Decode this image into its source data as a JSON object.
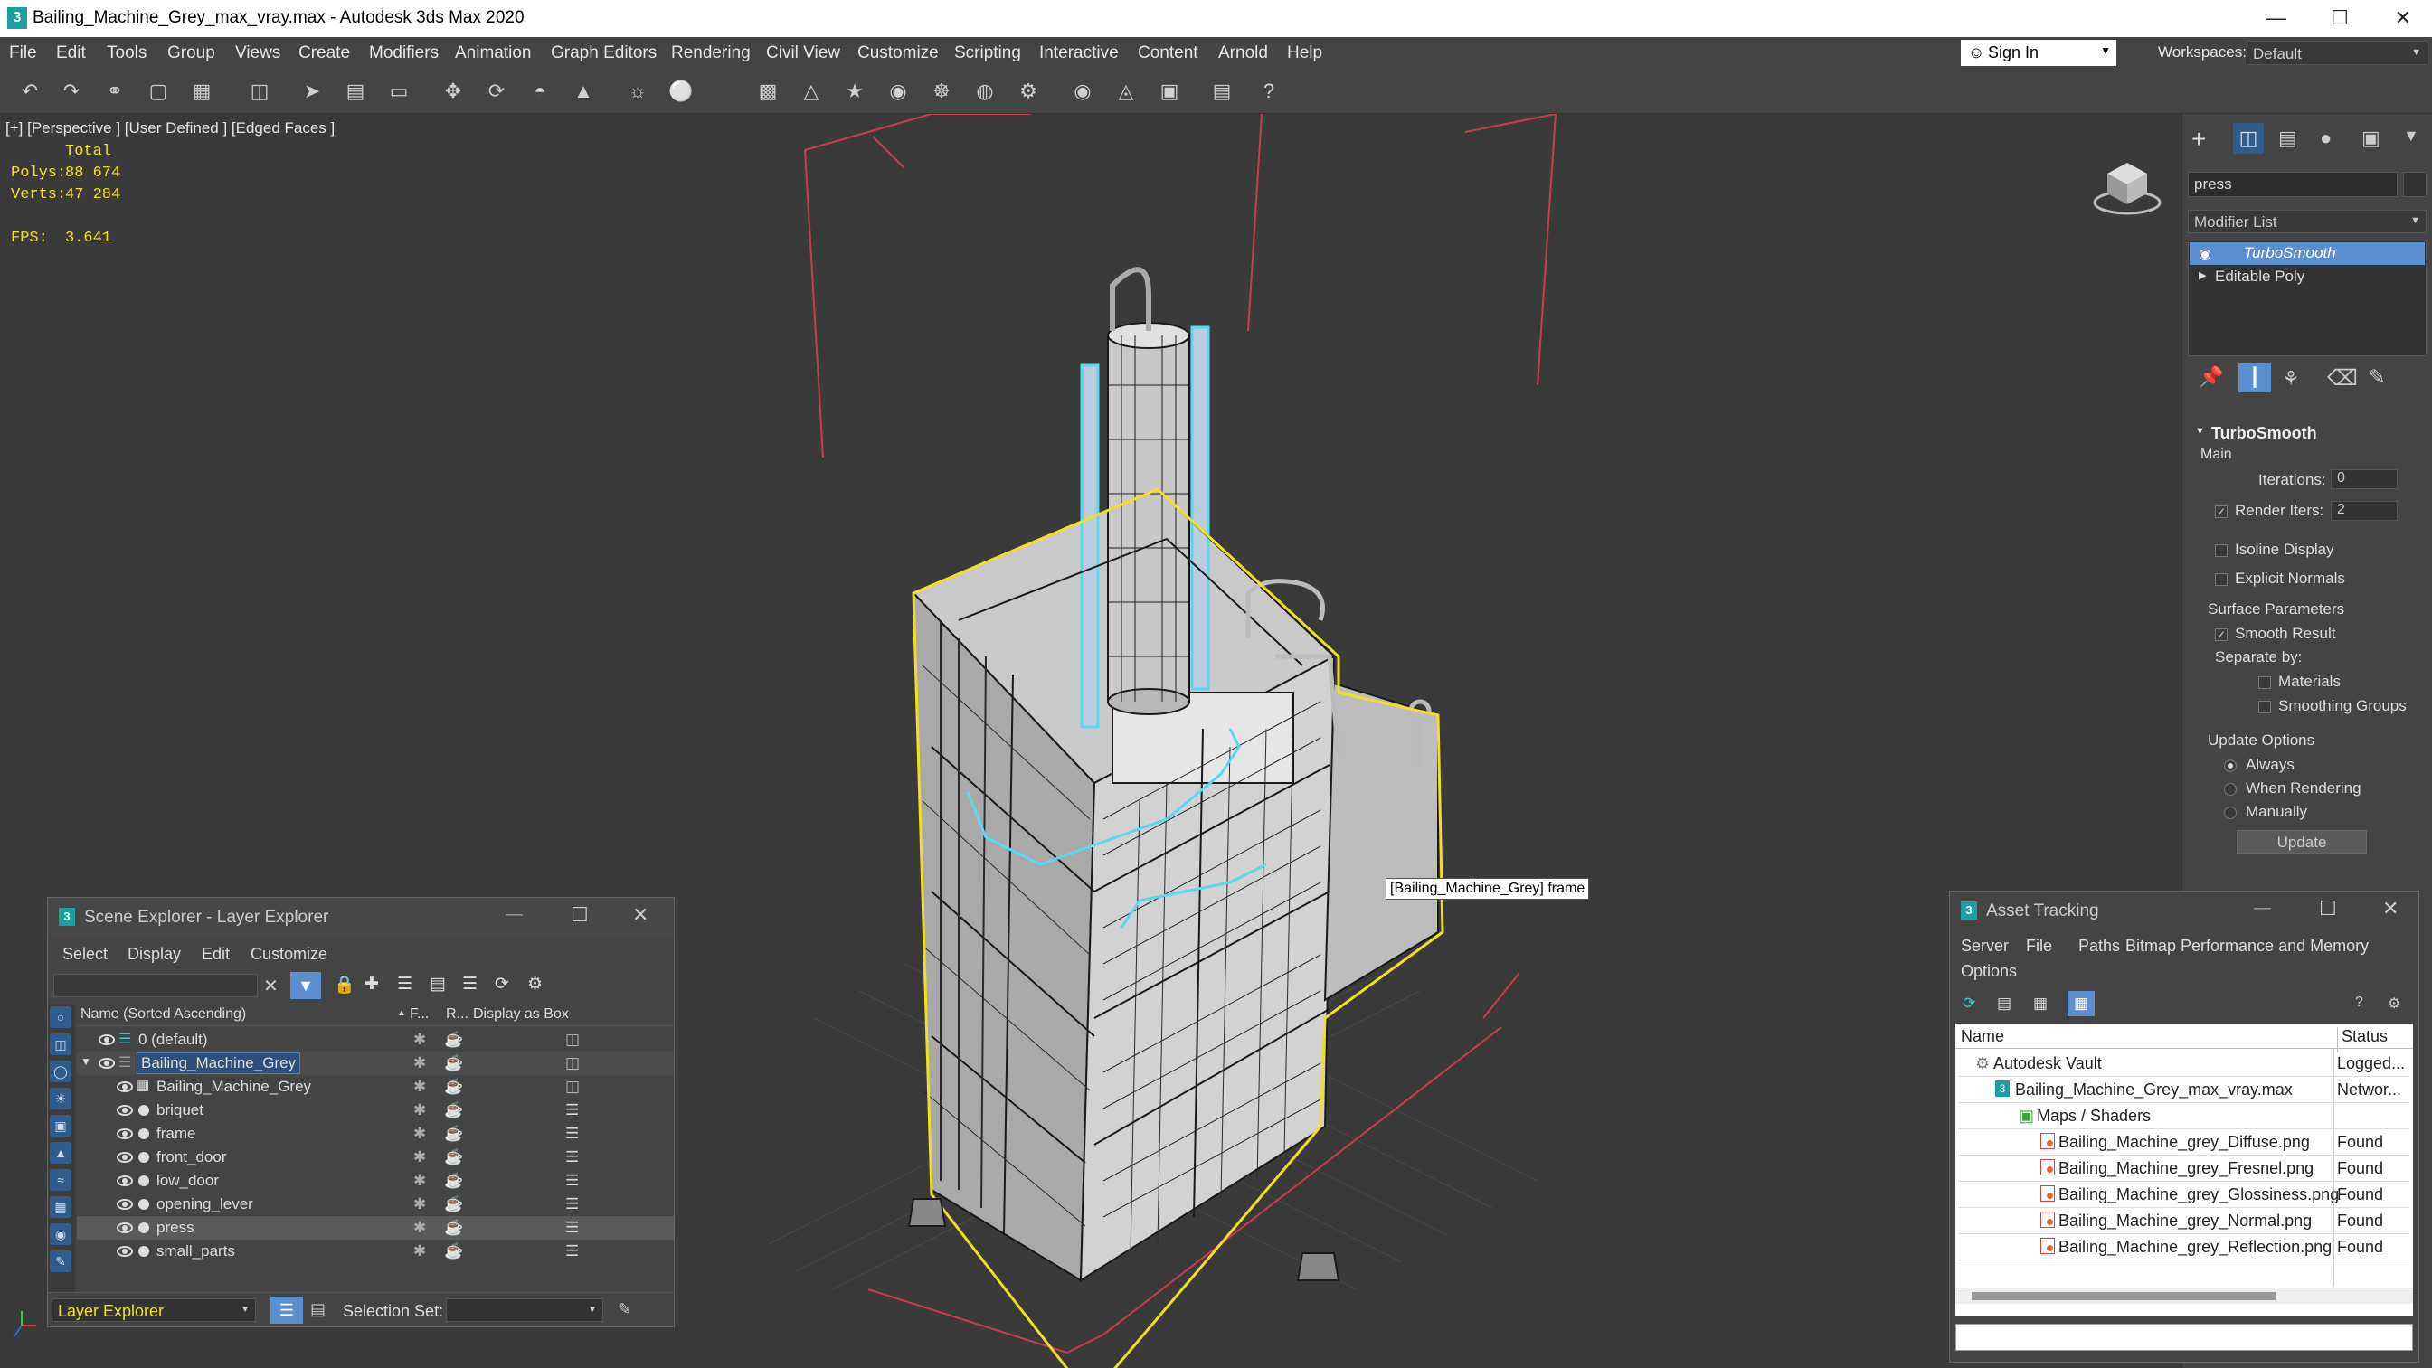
{
  "window": {
    "title": "Bailing_Machine_Grey_max_vray.max - Autodesk 3ds Max 2020",
    "minimize": "—",
    "maximize": "☐",
    "close": "✕"
  },
  "menu": [
    "File",
    "Edit",
    "Tools",
    "Group",
    "Views",
    "Create",
    "Modifiers",
    "Animation",
    "Graph Editors",
    "Rendering",
    "Civil View",
    "Customize",
    "Scripting",
    "Interactive",
    "Content",
    "Arnold",
    "Help"
  ],
  "signin": {
    "label": "Sign In",
    "workspaces_label": "Workspaces:",
    "workspace": "Default"
  },
  "viewport": {
    "label": "[+] [Perspective ] [User Defined ] [Edged Faces ]",
    "stats": {
      "total_label": "Total",
      "polys_label": "Polys:",
      "polys": "88 674",
      "verts_label": "Verts:",
      "verts": "47 284",
      "fps_label": "FPS:",
      "fps": "3.641"
    },
    "tooltip": "[Bailing_Machine_Grey] frame",
    "colors": {
      "bg": "#3a3a3a",
      "selection": "#f0e020",
      "highlight": "#5ad8f0",
      "wire": "#1a1a1a",
      "body": "#d2d2d2"
    }
  },
  "command_panel": {
    "search": "press",
    "modifier_list": "Modifier List",
    "stack": [
      "TurboSmooth",
      "Editable Poly"
    ],
    "rollout_title": "TurboSmooth",
    "main_label": "Main",
    "iterations_label": "Iterations:",
    "iterations": "0",
    "render_iters_label": "Render Iters:",
    "render_iters": "2",
    "isoline": "Isoline Display",
    "explicit_normals": "Explicit Normals",
    "surface_params": "Surface Parameters",
    "smooth_result": "Smooth Result",
    "separate_by": "Separate by:",
    "materials": "Materials",
    "smoothing_groups": "Smoothing Groups",
    "update_options": "Update Options",
    "always": "Always",
    "when_rendering": "When Rendering",
    "manually": "Manually",
    "update_button": "Update"
  },
  "scene_explorer": {
    "title": "Scene Explorer - Layer Explorer",
    "menu": [
      "Select",
      "Display",
      "Edit",
      "Customize"
    ],
    "col_name": "Name (Sorted Ascending)",
    "col_f": "F...",
    "col_r": "R...",
    "col_box": "Display as Box",
    "rows": [
      {
        "name": "0 (default)"
      },
      {
        "name": "Bailing_Machine_Grey"
      },
      {
        "name": "Bailing_Machine_Grey"
      },
      {
        "name": "briquet"
      },
      {
        "name": "frame"
      },
      {
        "name": "front_door"
      },
      {
        "name": "low_door"
      },
      {
        "name": "opening_lever"
      },
      {
        "name": "press"
      },
      {
        "name": "small_parts"
      }
    ],
    "footer_layer": "Layer Explorer",
    "selection_set_label": "Selection Set:"
  },
  "asset_tracking": {
    "title": "Asset Tracking",
    "menu": [
      "Server",
      "File",
      "Paths",
      "Bitmap Performance and Memory",
      "Options"
    ],
    "col_name": "Name",
    "col_status": "Status",
    "rows": [
      {
        "name": "Autodesk Vault",
        "status": "Logged..."
      },
      {
        "name": "Bailing_Machine_Grey_max_vray.max",
        "status": "Networ..."
      },
      {
        "name": "Maps / Shaders",
        "status": ""
      },
      {
        "name": "Bailing_Machine_grey_Diffuse.png",
        "status": "Found"
      },
      {
        "name": "Bailing_Machine_grey_Fresnel.png",
        "status": "Found"
      },
      {
        "name": "Bailing_Machine_grey_Glossiness.png",
        "status": "Found"
      },
      {
        "name": "Bailing_Machine_grey_Normal.png",
        "status": "Found"
      },
      {
        "name": "Bailing_Machine_grey_Reflection.png",
        "status": "Found"
      }
    ]
  }
}
